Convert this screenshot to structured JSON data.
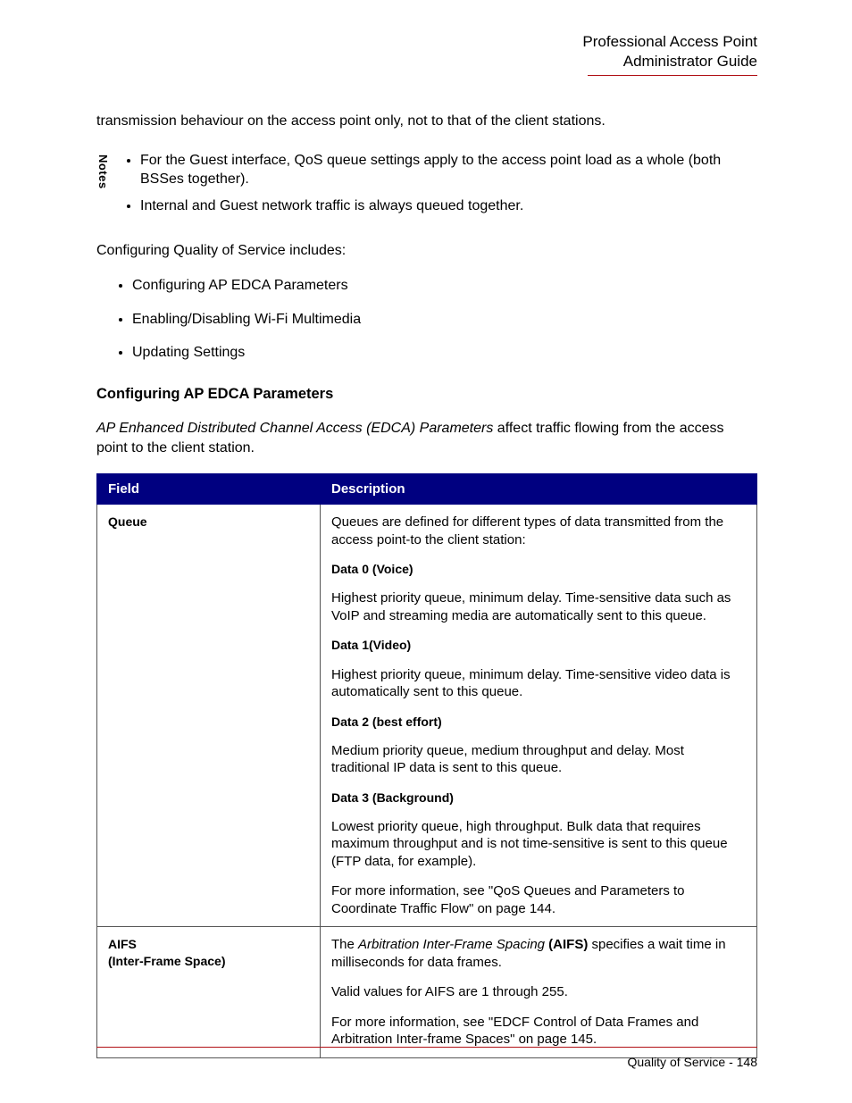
{
  "header": {
    "line1": "Professional Access Point",
    "line2": "Administrator Guide"
  },
  "intro": "transmission behaviour on the access point only, not to that of the client stations.",
  "notes": {
    "label": "Notes",
    "items": [
      {
        "prefix": "For the Guest interface, QoS queue settings apply to the access point load as a whole (both ",
        "link": "BSS",
        "suffix": "es together)."
      },
      {
        "text": "Internal and Guest network traffic is always queued together."
      }
    ]
  },
  "configIntro": "Configuring Quality of Service includes:",
  "configList": [
    "Configuring AP EDCA Parameters",
    "Enabling/Disabling Wi-Fi Multimedia",
    "Updating Settings"
  ],
  "section": {
    "heading": "Configuring AP EDCA Parameters",
    "desc_italic": "AP Enhanced Distributed Channel Access (EDCA) Parameters",
    "desc_rest": " affect traffic flowing from the access point to the client station."
  },
  "table": {
    "headers": [
      "Field",
      "Description"
    ],
    "rows": [
      {
        "field": "Queue",
        "desc": {
          "intro": "Queues are defined for different types of data transmitted from the access point-to the client station:",
          "items": [
            {
              "label": "Data 0 (Voice)",
              "text": "Highest priority queue, minimum delay. Time-sensitive data such as VoIP and streaming media are automatically sent to this queue."
            },
            {
              "label": "Data 1(Video)",
              "text": "Highest priority queue, minimum delay. Time-sensitive video data is automatically sent to this queue."
            },
            {
              "label": "Data 2 (best effort)",
              "text": "Medium priority queue, medium throughput and delay. Most traditional IP data is sent to this queue."
            },
            {
              "label": "Data 3 (Background)",
              "text": "Lowest priority queue, high throughput. Bulk data that requires maximum throughput and is not time-sensitive is sent to this queue (FTP data, for example)."
            }
          ],
          "more": "For more information, see \"QoS Queues and Parameters to Coordinate Traffic Flow\" on page 144."
        }
      },
      {
        "field_l1": "AIFS",
        "field_l2": "(Inter-Frame Space)",
        "desc": {
          "p1_pre": "The ",
          "p1_italic": "Arbitration Inter-Frame Spacing",
          "p1_bold_paren": " (AIFS)",
          "p1_post": " specifies a wait time in milliseconds for data frames.",
          "p2": "Valid values for AIFS are 1 through 255.",
          "p3": "For more information, see \"EDCF Control of Data Frames and Arbitration Inter-frame Spaces\" on page 145."
        }
      }
    ]
  },
  "footer": "Quality of Service - 148"
}
